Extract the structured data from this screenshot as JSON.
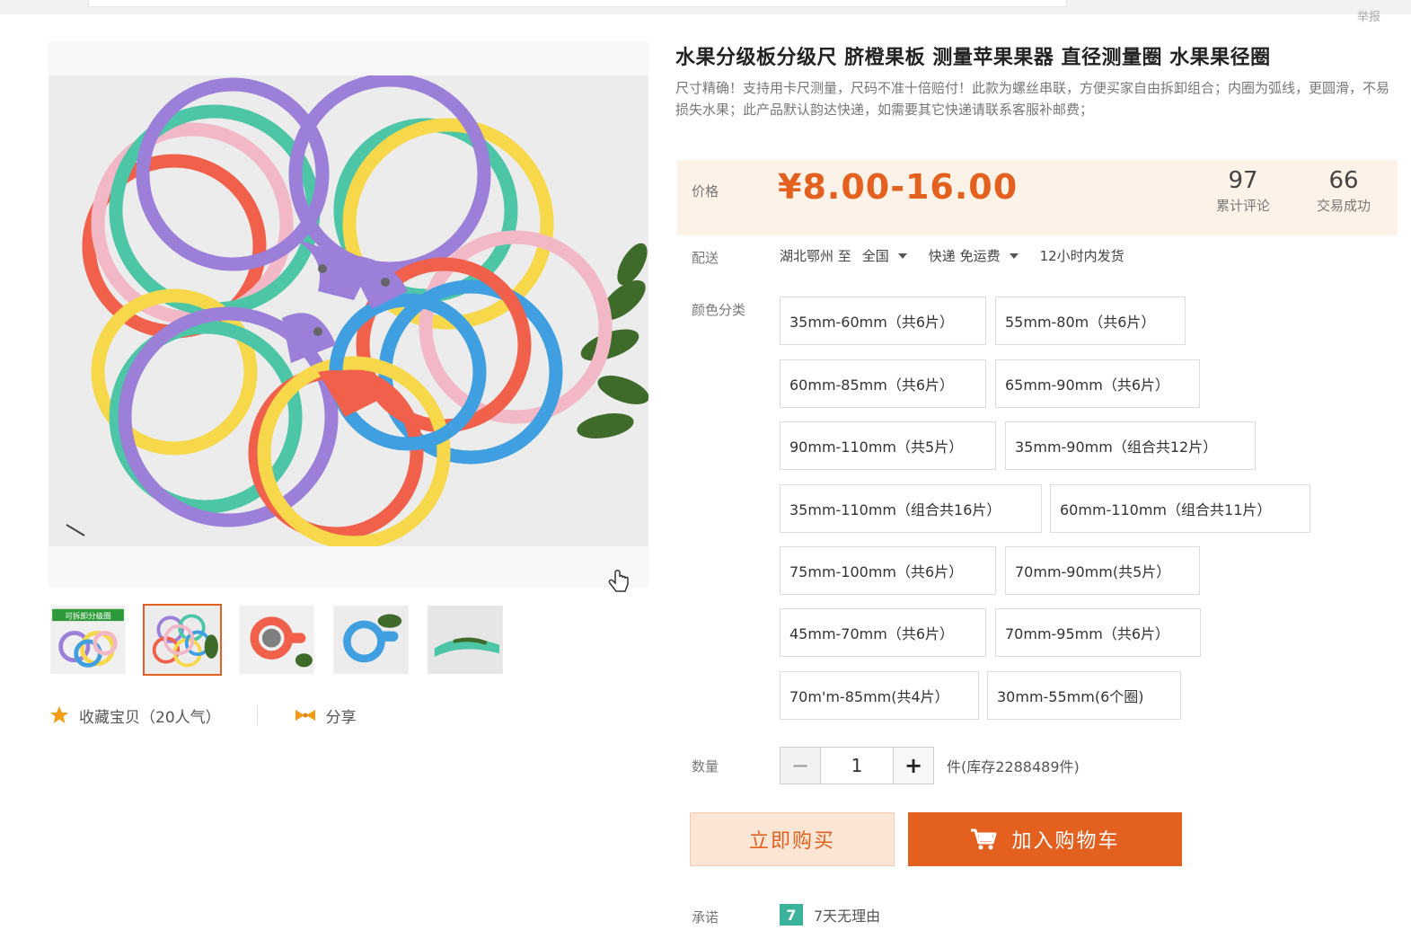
{
  "header": {
    "report_label": "举报"
  },
  "product": {
    "title": "水果分级板分级尺 脐橙果板 测量苹果果器 直径测量圈 水果果径圈",
    "description": "尺寸精确！支持用卡尺测量，尺码不准十倍赔付！此款为螺丝串联，方便买家自由拆卸组合；内圈为弧线，更圆滑，不易损失水果；此产品默认韵达快递，如需要其它快递请联系客服补邮费；"
  },
  "price": {
    "label": "价格",
    "value": "¥8.00-16.00",
    "reviews_count": "97",
    "reviews_label": "累计评论",
    "sales_count": "66",
    "sales_label": "交易成功"
  },
  "delivery": {
    "label": "配送",
    "from": "湖北鄂州 至",
    "to": "全国",
    "shipping": "快递 免运费",
    "dispatch": "12小时内发货"
  },
  "color": {
    "label": "颜色分类",
    "options": [
      "35mm-60mm（共6片）",
      "55mm-80m（共6片）",
      "60mm-85mm（共6片）",
      "65mm-90mm（共6片）",
      "90mm-110mm（共5片）",
      "35mm-90mm（组合共12片）",
      "35mm-110mm（组合共16片）",
      "60mm-110mm（组合共11片）",
      "75mm-100mm（共6片）",
      "70mm-90mm(共5片）",
      "45mm-70mm（共6片）",
      "70mm-95mm（共6片）",
      "70m'm-85mm(共4片）",
      "30mm-55mm(6个圈)"
    ]
  },
  "quantity": {
    "label": "数量",
    "minus": "−",
    "value": "1",
    "plus": "+",
    "stock": "件(库存2288489件)"
  },
  "actions": {
    "buy_now": "立即购买",
    "add_to_cart": "加入购物车"
  },
  "promise": {
    "label": "承诺",
    "badge": "7",
    "text": "7天无理由"
  },
  "gallery": {
    "favorite": "收藏宝贝（20人气）",
    "share": "分享",
    "thumb_banner": "可拆卸分级圈"
  },
  "colors": {
    "accent": "#e4601f",
    "price_bg": "#fdf2e8",
    "purple": "#9b7fd9",
    "teal": "#4cc6a6",
    "pink": "#f2b8c6",
    "yellow": "#f6d84a",
    "red": "#f0604a",
    "blue": "#3f9fe0"
  }
}
